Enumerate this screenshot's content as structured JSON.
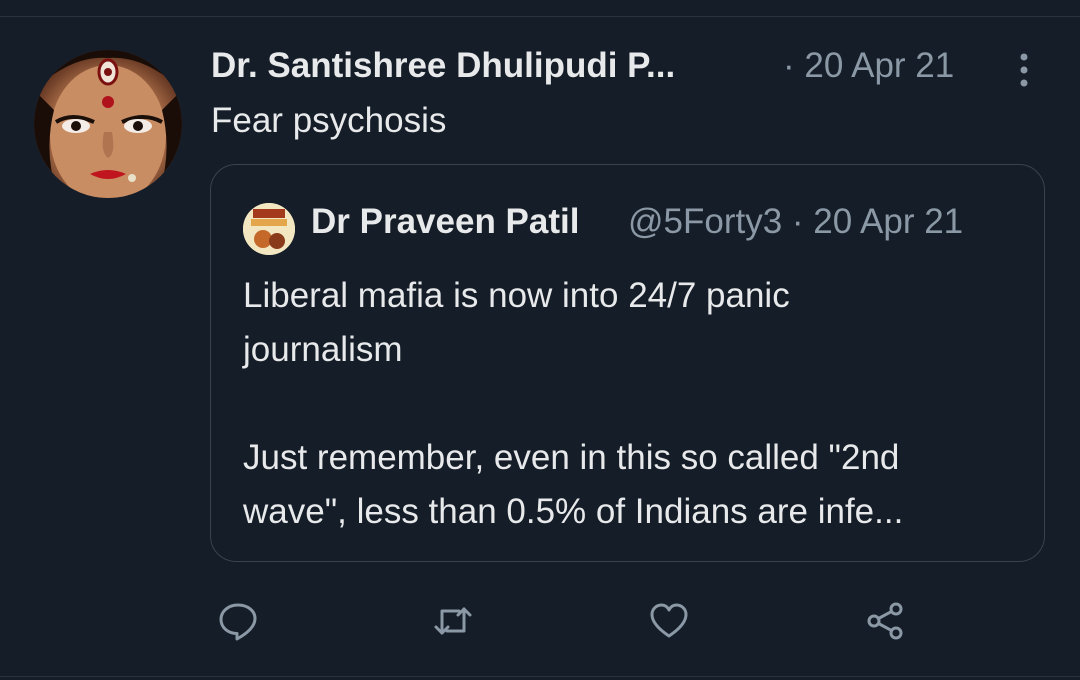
{
  "tweet": {
    "display_name": "Dr. Santishree Dhulipudi P...",
    "timestamp": "· 20 Apr 21",
    "text": "Fear psychosis"
  },
  "quote": {
    "display_name": "Dr Praveen Patil",
    "handle_time": "@5Forty3 · 20 Apr 21",
    "lines": [
      "Liberal mafia is now into 24/7 panic",
      "journalism",
      "",
      "Just remember, even in this so called \"2nd",
      "wave\", less than 0.5% of Indians are infe..."
    ]
  },
  "actions": {
    "reply_icon": "reply-icon",
    "retweet_icon": "retweet-icon",
    "like_icon": "heart-icon",
    "share_icon": "share-icon"
  },
  "colors": {
    "background": "#151d28",
    "primary_text": "#e7e9ea",
    "secondary_text": "#8b98a5",
    "border": "#38444d"
  }
}
